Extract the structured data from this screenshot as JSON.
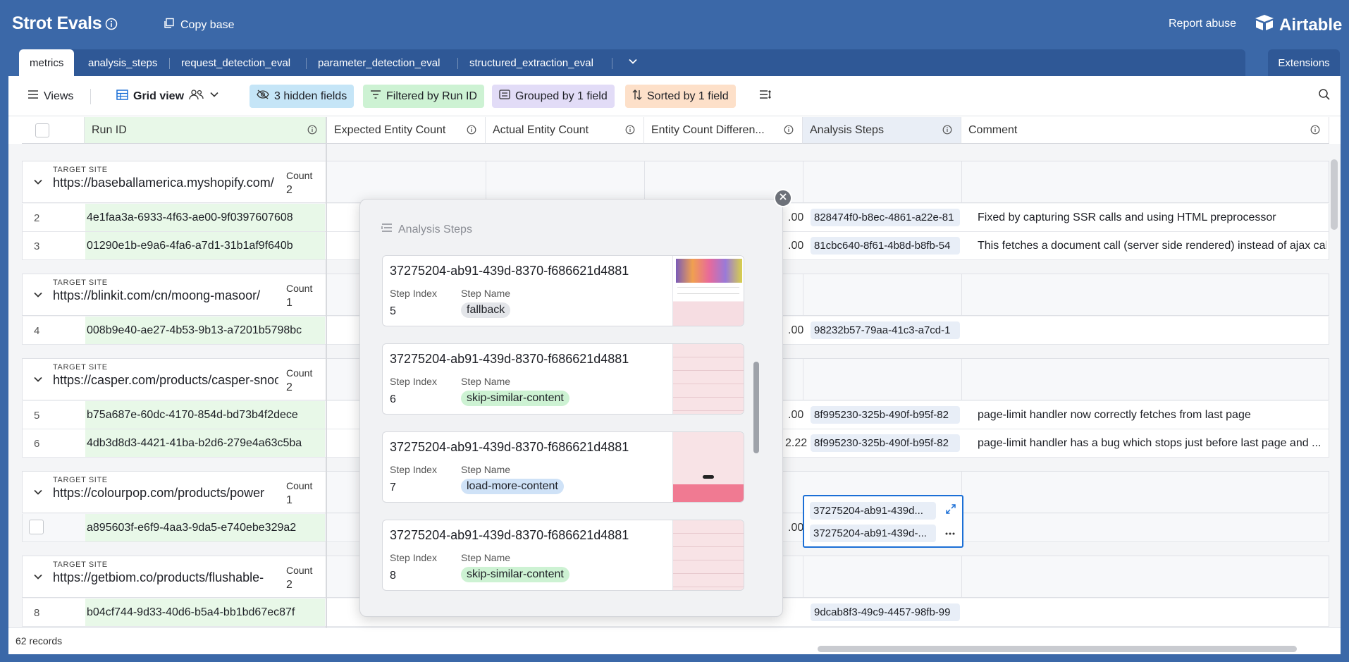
{
  "app": {
    "title": "Strot Evals",
    "copy_base": "Copy base",
    "report_abuse": "Report abuse",
    "brand": "Airtable"
  },
  "tabs": [
    {
      "label": "metrics"
    },
    {
      "label": "analysis_steps"
    },
    {
      "label": "request_detection_eval"
    },
    {
      "label": "parameter_detection_eval"
    },
    {
      "label": "structured_extraction_eval"
    }
  ],
  "extensions": "Extensions",
  "toolbar": {
    "views": "Views",
    "grid_view": "Grid view",
    "hidden_fields": "3 hidden fields",
    "filtered": "Filtered by Run ID",
    "grouped": "Grouped by 1 field",
    "sorted": "Sorted by 1 field"
  },
  "columns": [
    "Run ID",
    "Expected Entity Count",
    "Actual Entity Count",
    "Entity Count Differen...",
    "Analysis Steps",
    "Comment"
  ],
  "group_label": "TARGET SITE",
  "count_label": "Count",
  "groups": [
    {
      "site": "https://baseballamerica.myshopify.com/",
      "count": "2"
    },
    {
      "site": "https://blinkit.com/cn/moong-masoor/",
      "count": "1"
    },
    {
      "site": "https://casper.com/products/casper-snooze",
      "count": "2"
    },
    {
      "site": "https://colourpop.com/products/power",
      "count": "1"
    },
    {
      "site": "https://getbiom.co/products/flushable-",
      "count": "2"
    }
  ],
  "rows": [
    {
      "num": "2",
      "run_id": "4e1faa3a-6933-4f63-ae00-9f0397607608",
      "peek": ".00",
      "steps": "828474f0-b8ec-4861-a22e-81",
      "comment": "Fixed by capturing SSR calls and using HTML preprocessor"
    },
    {
      "num": "3",
      "run_id": "01290e1b-e9a6-4fa6-a7d1-31b1af9f640b",
      "peek": ".00",
      "steps": "81cbc640-8f61-4b8d-b8fb-54",
      "comment": "This fetches a document call (server side rendered) instead of ajax call"
    },
    {
      "num": "4",
      "run_id": "008b9e40-ae27-4b53-9b13-a7201b5798bc",
      "peek": ".00",
      "steps": "98232b57-79aa-41c3-a7cd-1",
      "comment": ""
    },
    {
      "num": "5",
      "run_id": "b75a687e-60dc-4170-854d-bd73b4f2dece",
      "peek": ".00",
      "steps": "8f995230-325b-490f-b95f-82",
      "comment": "page-limit handler now correctly fetches from last page"
    },
    {
      "num": "6",
      "run_id": "4db3d8d3-4421-41ba-b2d6-279e4a63c5ba",
      "peek": "2.22",
      "steps": "8f995230-325b-490f-b95f-82",
      "comment": "page-limit handler has a bug which stops just before last page and ..."
    },
    {
      "num": "",
      "run_id": "a895603f-e6f9-4aa3-9da5-e740ebe329a2",
      "peek": ".00",
      "steps": "",
      "comment": ""
    },
    {
      "num": "8",
      "run_id": "b04cf744-9d33-40d6-b5a4-bb1bd67ec87f",
      "peek": "",
      "steps": "9dcab8f3-49c9-4457-98fb-99",
      "comment": ""
    }
  ],
  "selected_cell": {
    "chip1": "37275204-ab91-439d...",
    "chip2": "37275204-ab91-439d-..."
  },
  "popup": {
    "title": "Analysis Steps",
    "step_index_label": "Step Index",
    "step_name_label": "Step Name",
    "cards": [
      {
        "title": "37275204-ab91-439d-8370-f686621d4881",
        "index": "5",
        "name": "fallback",
        "color": "#e3e5e9"
      },
      {
        "title": "37275204-ab91-439d-8370-f686621d4881",
        "index": "6",
        "name": "skip-similar-content",
        "color": "#cdf2d3"
      },
      {
        "title": "37275204-ab91-439d-8370-f686621d4881",
        "index": "7",
        "name": "load-more-content",
        "color": "#cfe2f7"
      },
      {
        "title": "37275204-ab91-439d-8370-f686621d4881",
        "index": "8",
        "name": "skip-similar-content",
        "color": "#cdf2d3"
      }
    ]
  },
  "footer": {
    "records": "62 records"
  }
}
